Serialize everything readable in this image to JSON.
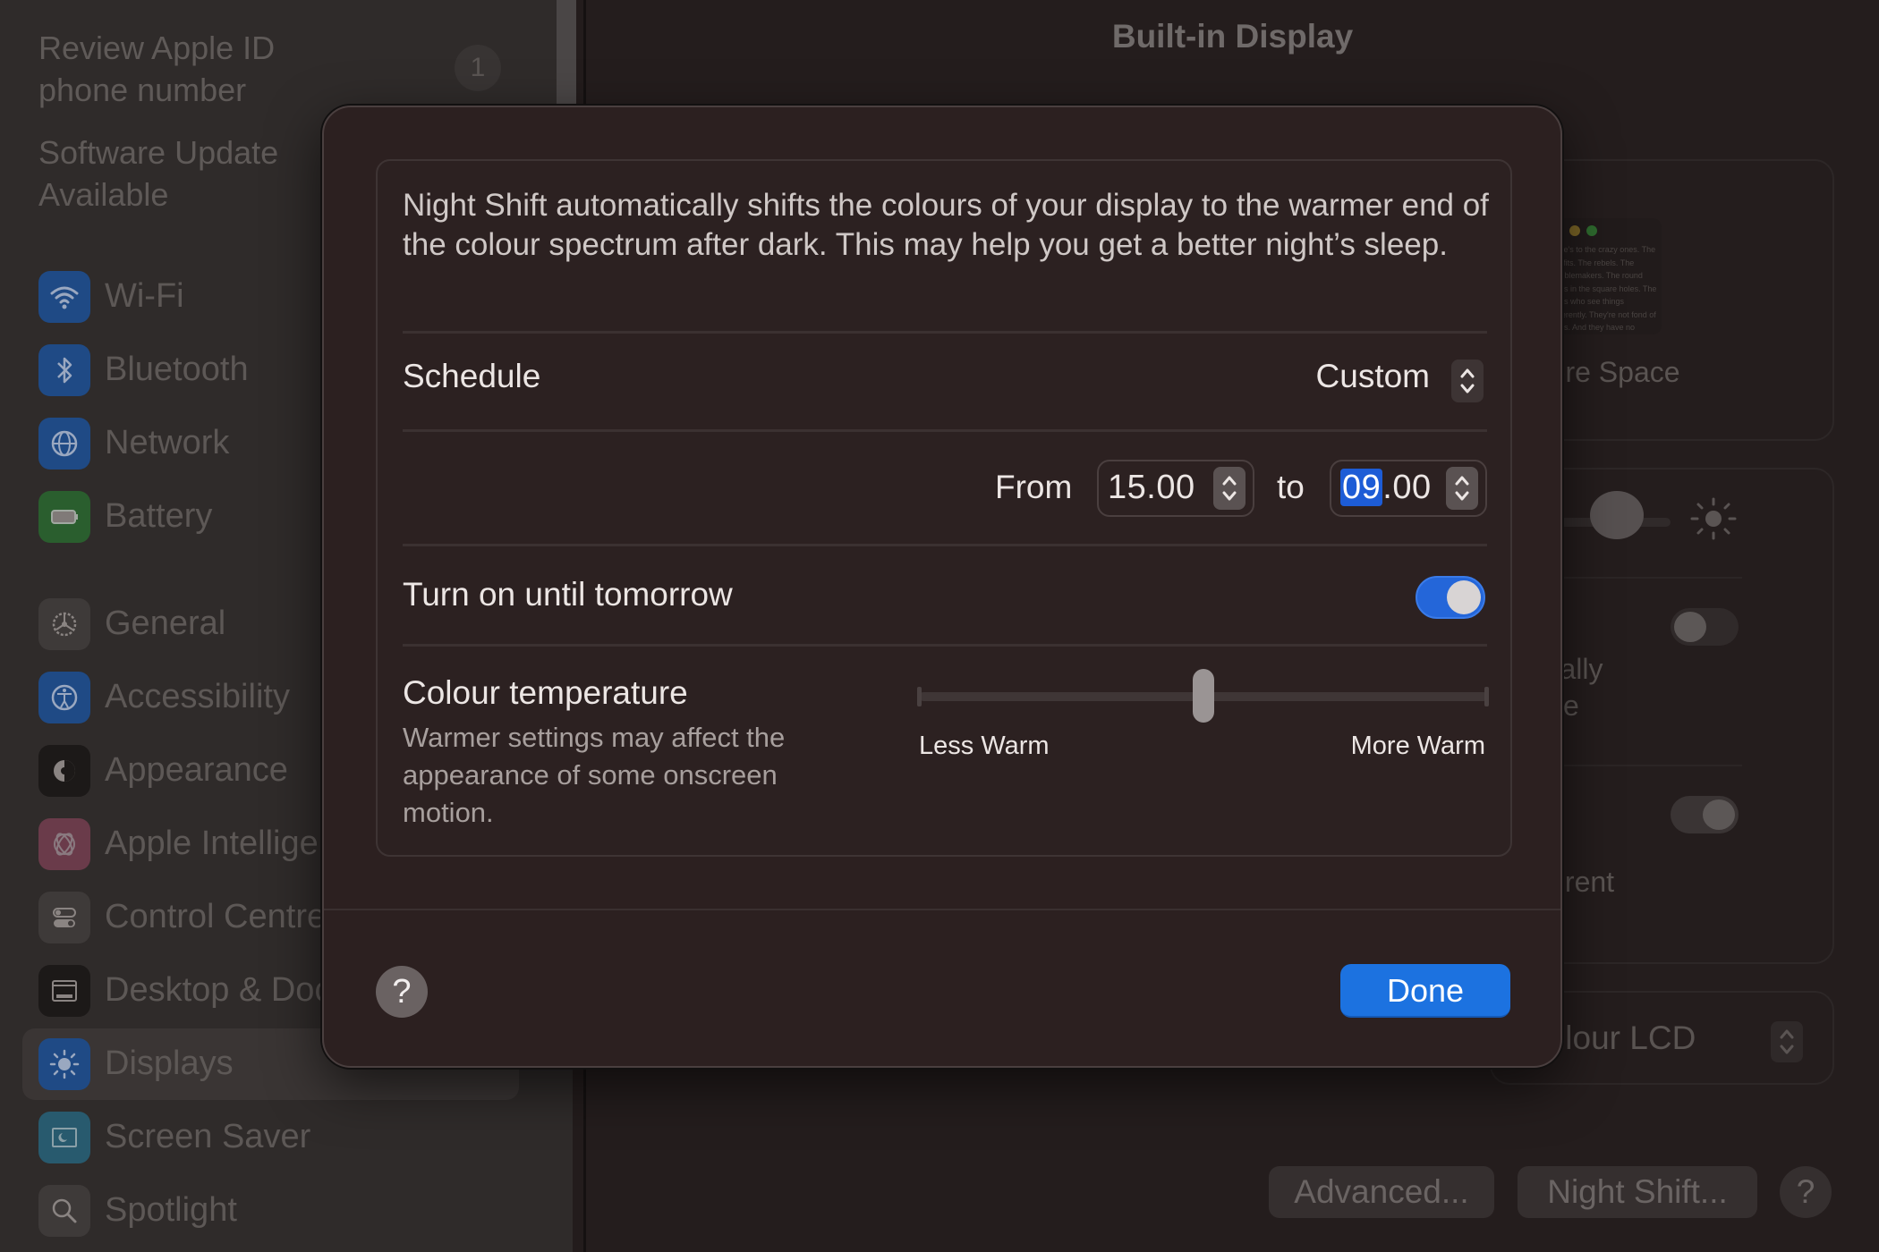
{
  "sidebar": {
    "notices": [
      {
        "label": "Review Apple ID\nphone number",
        "badge": "1"
      },
      {
        "label": "Software Update\nAvailable"
      }
    ],
    "items": [
      {
        "label": "Wi-Fi",
        "icon": "wifi-icon",
        "color": "#1f4a85"
      },
      {
        "label": "Bluetooth",
        "icon": "bluetooth-icon",
        "color": "#1f4a85"
      },
      {
        "label": "Network",
        "icon": "globe-icon",
        "color": "#1f4a85"
      },
      {
        "label": "Battery",
        "icon": "battery-icon",
        "color": "#2a5e2e"
      },
      {
        "label": "General",
        "icon": "gear-icon",
        "color": "#3e3a39"
      },
      {
        "label": "Accessibility",
        "icon": "accessibility-icon",
        "color": "#1f4a85"
      },
      {
        "label": "Appearance",
        "icon": "appearance-icon",
        "color": "#1c1918"
      },
      {
        "label": "Apple Intelligence",
        "icon": "apple-intelligence-icon",
        "color": "#6a3b4a"
      },
      {
        "label": "Control Centre",
        "icon": "control-centre-icon",
        "color": "#3e3a39"
      },
      {
        "label": "Desktop & Dock",
        "icon": "desktop-dock-icon",
        "color": "#1c1918"
      },
      {
        "label": "Displays",
        "icon": "displays-icon",
        "color": "#1f4a85",
        "selected": true
      },
      {
        "label": "Screen Saver",
        "icon": "screen-saver-icon",
        "color": "#285a6e"
      },
      {
        "label": "Spotlight",
        "icon": "spotlight-icon",
        "color": "#3e3a39"
      }
    ]
  },
  "main": {
    "title": "Built-in Display",
    "resolution_option": "More Space",
    "preview_text": "Here's to the crazy ones. The misfits. The rebels. The troublemakers. The round pegs in the square holes. The ones who see things differently. They're not fond of rules. And they have no respect for the status quo. You can quote them, disagree with them, glorify or vilify them. About the only thing you can't do is ignore them. Because they change things.",
    "auto_brightness_text": [
      "matically",
      "er time"
    ],
    "true_tone_text": "different",
    "auto_brightness_on": false,
    "true_tone_on": true,
    "colour_profile": "Colour LCD",
    "buttons": {
      "advanced": "Advanced...",
      "night_shift": "Night Shift...",
      "help": "?"
    }
  },
  "dialog": {
    "description": "Night Shift automatically shifts the colours of your display to the warmer end of the colour spectrum after dark. This may help you get a better night’s sleep.",
    "schedule_label": "Schedule",
    "schedule_value": "Custom",
    "from_label": "From",
    "from_value": "15.00",
    "to_label": "to",
    "to_value_selected": "09",
    "to_value_rest": ".00",
    "turn_on_label": "Turn on until tomorrow",
    "turn_on_enabled": true,
    "colour_temp_label": "Colour temperature",
    "colour_temp_sub": "Warmer settings may affect the appearance of some onscreen motion.",
    "colour_temp_value": 0.5,
    "less_warm_label": "Less Warm",
    "more_warm_label": "More Warm",
    "help_label": "?",
    "done_label": "Done",
    "accent_color": "#1c72e0"
  }
}
